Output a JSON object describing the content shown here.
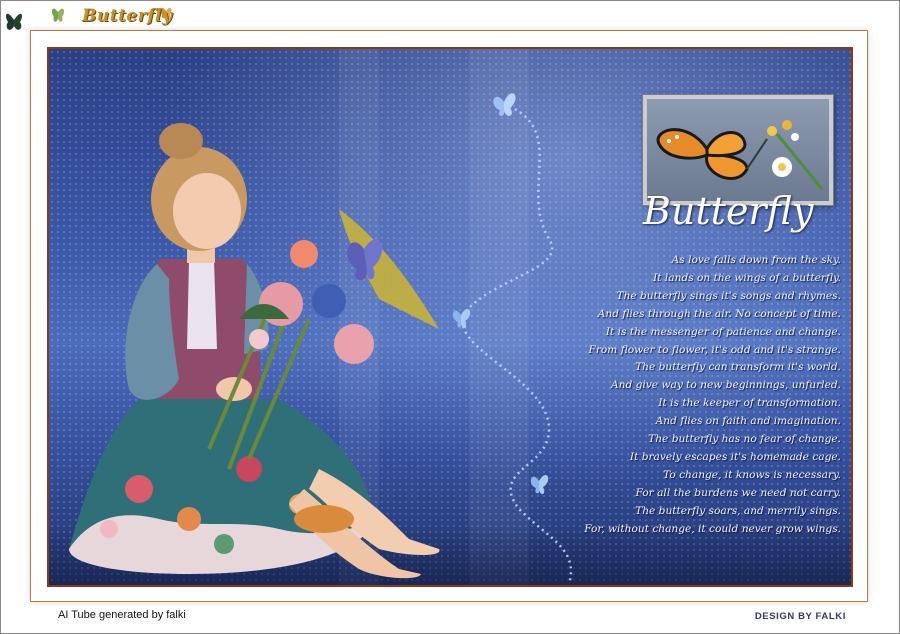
{
  "header": {
    "logo_text": "Butterfly"
  },
  "artwork": {
    "title": "Butterfly",
    "poem": [
      "As love falls down from the sky.",
      "It lands on the wings of a butterfly.",
      "The butterfly sings it's songs and rhymes.",
      "And flies through the air. No concept of time.",
      "It is the messenger of patience and change.",
      "From flower to flower, it's odd and it's strange.",
      "The butterfly can transform it's world.",
      "And give way to new beginnings, unfurled.",
      "It is the keeper of transformation.",
      "And flies on faith and imagination.",
      "The butterfly has no fear of change.",
      "It bravely escapes it's homemade cage.",
      "To change, it knows is necessary.",
      "For all the burdens we need not carry.",
      "The butterfly soars, and merrily sings.",
      "For, without change, it could never grow wings."
    ]
  },
  "footer": {
    "credit": "AI Tube generated by falki",
    "design": "DESIGN BY FALKI"
  },
  "colors": {
    "frame_border": "#8a3a12",
    "sky_blue": "#3b58a8",
    "logo_gold": "#c9902a"
  }
}
